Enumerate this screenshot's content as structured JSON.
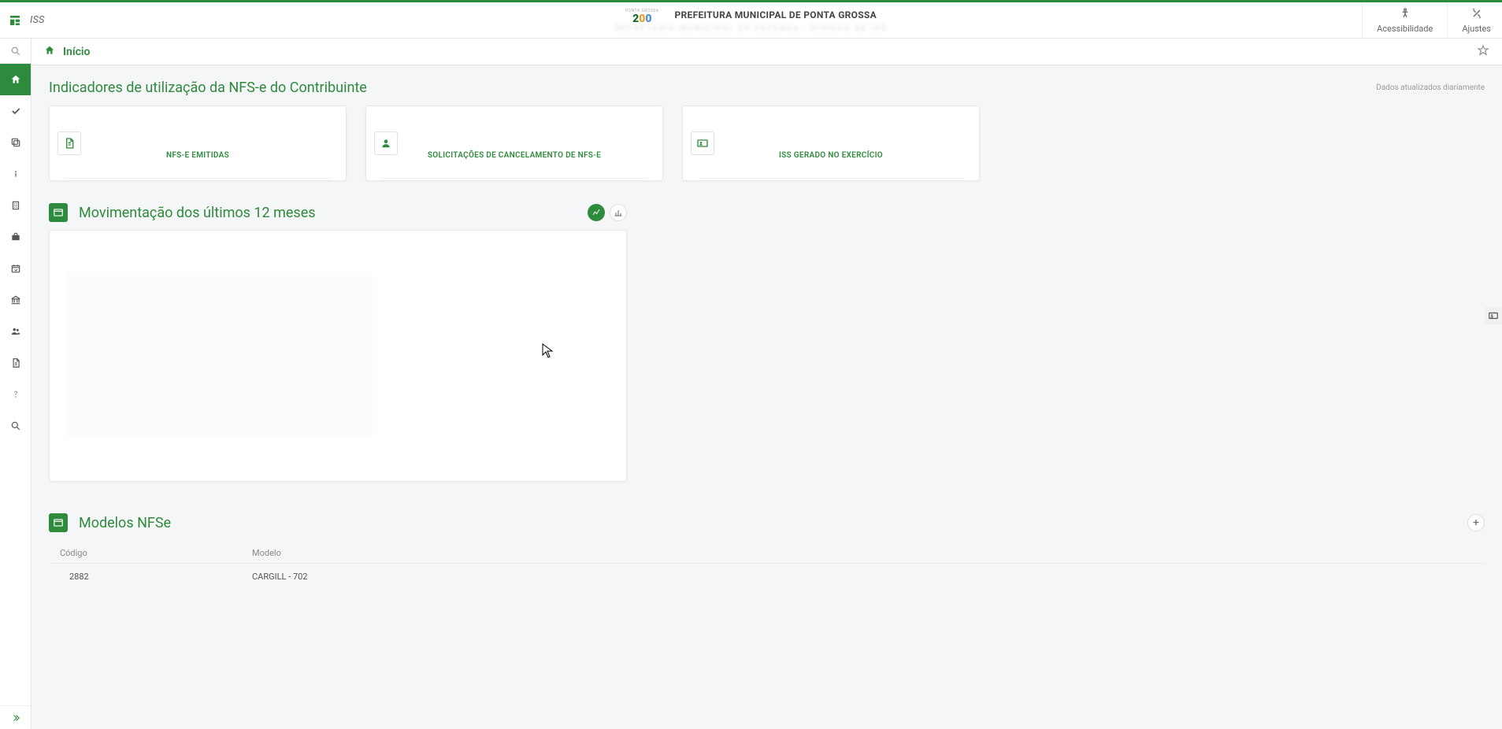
{
  "app": {
    "name": "ISS"
  },
  "header": {
    "title": "PREFEITURA MUNICIPAL DE PONTA GROSSA",
    "subtitle": "SECRETARIA MUNICIPAL DA FAZENDA - DIVISAO DE ISS",
    "accessibility": "Acessibilidade",
    "settings": "Ajustes",
    "logo_top": "PONTA GROSSA"
  },
  "breadcrumb": {
    "label": "Início"
  },
  "sections": {
    "indicators": {
      "title": "Indicadores de utilização da NFS-e do Contribuinte",
      "aside": "Dados atualizados diariamente",
      "cards": [
        {
          "label": "NFS-E EMITIDAS",
          "icon": "file"
        },
        {
          "label": "SOLICITAÇÕES DE CANCELAMENTO DE NFS-E",
          "icon": "user"
        },
        {
          "label": "ISS GERADO NO EXERCÍCIO",
          "icon": "id-card"
        }
      ]
    },
    "movement": {
      "title": "Movimentação dos últimos 12 meses"
    },
    "models": {
      "title": "Modelos NFSe",
      "columns": {
        "code": "Código",
        "model": "Modelo"
      },
      "rows": [
        {
          "code": "2882",
          "model": "CARGILL - 702"
        }
      ]
    }
  }
}
